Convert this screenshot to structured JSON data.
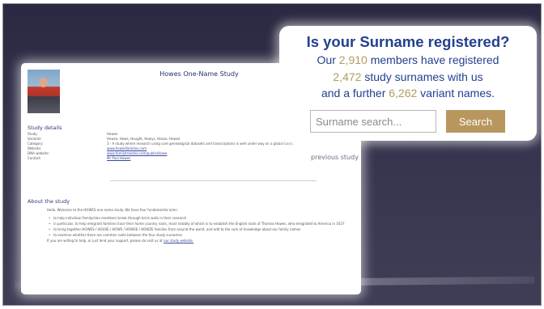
{
  "page": {
    "title": "Howes One-Name Study",
    "details_heading": "Study details",
    "details": [
      {
        "label": "Study:",
        "value": "Howes"
      },
      {
        "label": "Variants:",
        "value": "Howse, Hows, Hought, Howys, Hoose, Howze"
      },
      {
        "label": "Category:",
        "value": "3 - A study where research using core genealogical datasets and transcriptions is well under way on a global basis."
      },
      {
        "label": "Website:",
        "value": "www.howesfamilies.com",
        "link": true
      },
      {
        "label": "DNA website:",
        "value": "www.familytreedna.com/public/Howe",
        "link": true
      },
      {
        "label": "Contact:",
        "value": "Mr Paul Howes",
        "link": true
      }
    ],
    "about_heading": "About the study",
    "about_intro": "Hello. Welcome to the HOWES one-name study. We have four fundamental aims:",
    "about_items": [
      "to help individual family/clan members break through brick walls in their research",
      "in particular, to help emigrant families trace their home country roots, most notably of which is to establish the English roots of Thomas Howes, who emigrated to America in 1637",
      "to bring together HOWES / HOUSE / HOWS / HOWSE / HOWZE families from around the world, and add to the sum of knowledge about our family names",
      "to examine whether there are common roots between the four study surnames"
    ],
    "about_footer": "If you are willing to help, or just lend your support, please do visit us at",
    "about_footer_link": "our study website.",
    "faded_text": "previous study"
  },
  "callout": {
    "title": "Is your Surname registered?",
    "line1_pre": "Our ",
    "members": "2,910",
    "line1_post": " members have registered",
    "surnames": "2,472",
    "line2_post": " study surnames with us",
    "line3_pre": "and a further ",
    "variants": "6,262",
    "line3_post": " variant names.",
    "search_placeholder": "Surname search...",
    "search_label": "Search"
  },
  "colors": {
    "accent": "#b8975e",
    "heading_blue": "#23408e",
    "background": "#2f2e47"
  }
}
